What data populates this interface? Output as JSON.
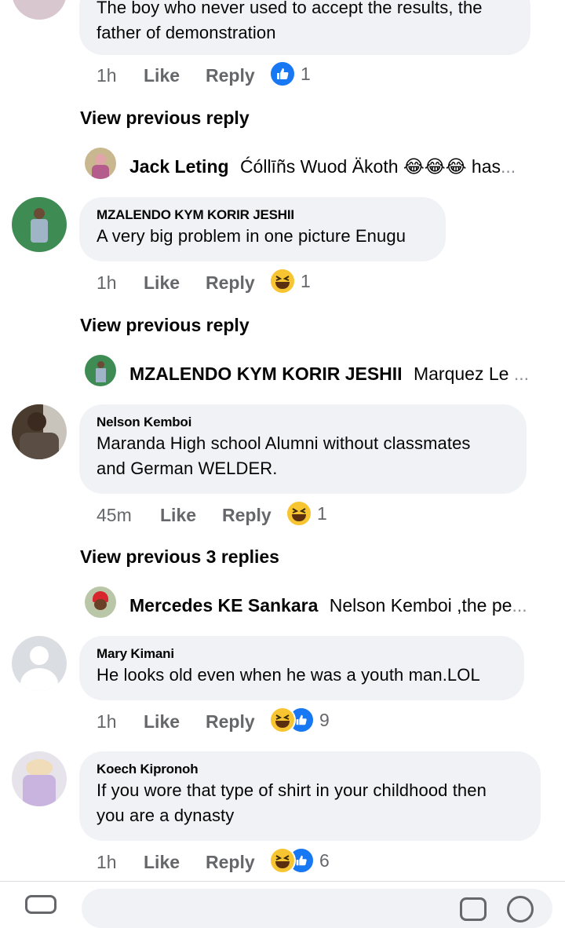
{
  "top_comment": {
    "text_partial": "The boy who never used to accept the results, the",
    "text_line2": "father of demonstration",
    "time": "1h",
    "like": "Like",
    "reply": "Reply",
    "reaction_count": "1"
  },
  "thread1": {
    "view_previous": "View previous reply",
    "reply_preview": {
      "name": "Jack Leting",
      "text": "Ćóllīñs Wuod Äkoth 😂😂😂 has",
      "ellipsis": "..."
    }
  },
  "comment1": {
    "author": "MZALENDO KYM KORIR JESHII",
    "text": "A very big problem in one picture Enugu",
    "time": "1h",
    "like": "Like",
    "reply": "Reply",
    "reaction_count": "1"
  },
  "thread2": {
    "view_previous": "View previous reply",
    "reply_preview": {
      "name": "MZALENDO KYM KORIR JESHII",
      "text": "Marquez Le",
      "ellipsis": "..."
    }
  },
  "comment2": {
    "author": "Nelson Kemboi",
    "text_line1": "Maranda High school Alumni without classmates",
    "text_line2": "and German WELDER.",
    "time": "45m",
    "like": "Like",
    "reply": "Reply",
    "reaction_count": "1"
  },
  "thread3": {
    "view_previous": "View previous 3 replies",
    "reply_preview": {
      "name": "Mercedes KE Sankara",
      "text": "Nelson Kemboi ,the pe",
      "ellipsis": "..."
    }
  },
  "comment3": {
    "author": "Mary Kimani",
    "text": "He looks old even when he was a youth man.LOL",
    "time": "1h",
    "like": "Like",
    "reply": "Reply",
    "reaction_count": "9"
  },
  "comment4": {
    "author": "Koech Kipronoh",
    "text_line1": "If you wore that type of shirt in your childhood then",
    "text_line2": "you are a dynasty",
    "time": "1h",
    "like": "Like",
    "reply": "Reply",
    "reaction_count": "6"
  },
  "colors": {
    "bubble": "#f0f2f5",
    "meta": "#65676b",
    "like_blue": "#1877f2",
    "haha_yellow": "#f7c532"
  }
}
